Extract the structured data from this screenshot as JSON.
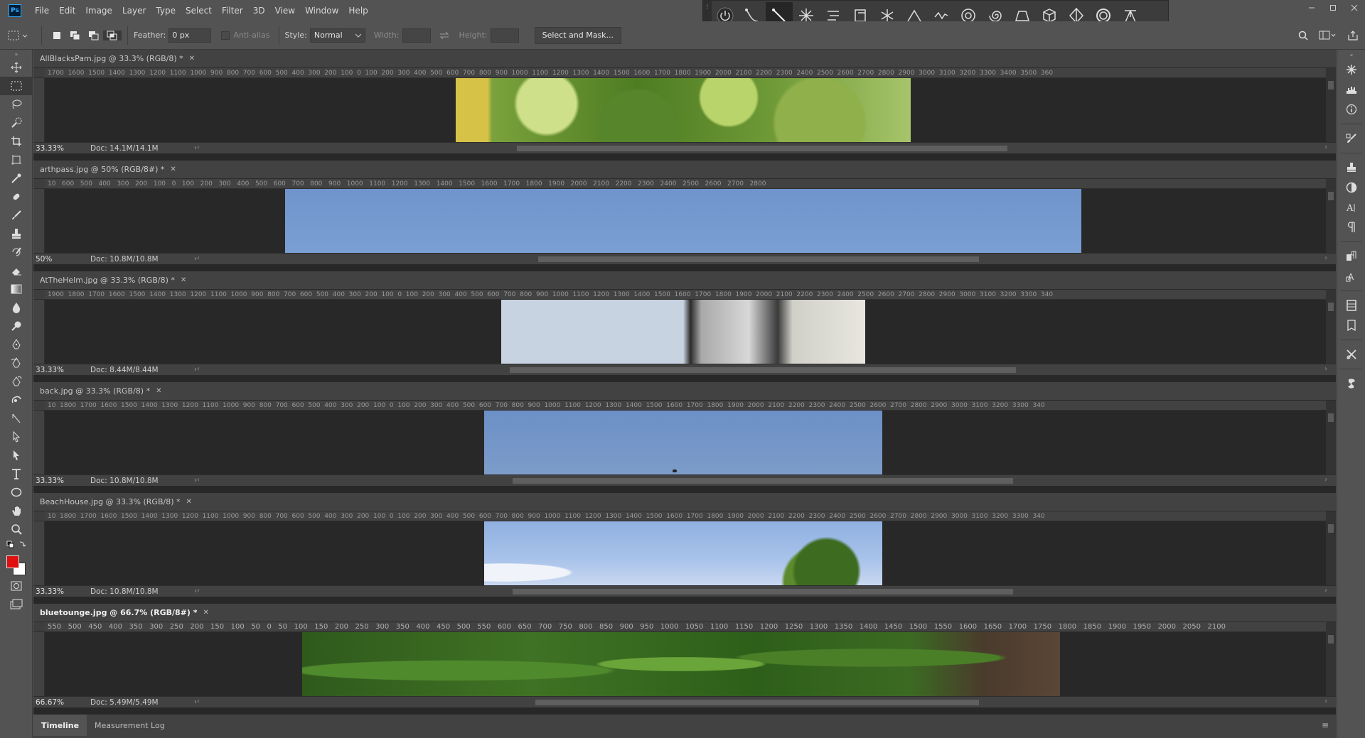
{
  "app": {
    "logo": "Ps",
    "menu": [
      "File",
      "Edit",
      "Image",
      "Layer",
      "Type",
      "Select",
      "Filter",
      "3D",
      "View",
      "Window",
      "Help"
    ],
    "window_controls": [
      "minimize-icon",
      "restore-icon",
      "close-icon"
    ]
  },
  "float_panel": {
    "icons": [
      "power-icon",
      "pen-curve-icon",
      "line-tool-icon",
      "starburst-icon",
      "align-lines-icon",
      "frame-icon",
      "snowflake-icon",
      "angle-icon",
      "wave-icon",
      "circle-target-icon",
      "spiral-icon",
      "perspective-box-icon",
      "cube-icon",
      "diamond-icon",
      "ring-icon",
      "tripod-icon"
    ]
  },
  "options": {
    "feather_label": "Feather:",
    "feather_value": "0 px",
    "antialias_label": "Anti-alias",
    "style_label": "Style:",
    "style_value": "Normal",
    "width_label": "Width:",
    "height_label": "Height:",
    "select_mask_label": "Select and Mask..."
  },
  "documents": [
    {
      "title": "AllBlacksPam.jpg @ 33.3% (RGB/8) *",
      "zoom": "33.33%",
      "doc_size": "Doc: 14.1M/14.1M",
      "ruler": "1700  1600  1500  1400  1300  1200  1100  1000  900  800  700  600  500  400  300  200  100  0  100  200  300  400  500  600  700  800  900  1000  1100  1200  1300  1400  1500  1600  1700  1800  1900  2000  2100  2200  2300  2400  2500  2600  2700  2800  2900  3000  3100  3200  3300  3400  3500  360",
      "active": false
    },
    {
      "title": "arthpass.jpg @ 50% (RGB/8#) *",
      "zoom": "50%",
      "doc_size": "Doc: 10.8M/10.8M",
      "ruler": "10   600   500   400   300   200   100   0   100   200   300   400   500   600   700   800   900   1000   1100   1200   1300   1400   1500   1600   1700   1800   1900   2000   2100   2200   2300   2400   2500   2600   2700   2800",
      "active": false
    },
    {
      "title": "AtTheHelm.jpg @ 33.3% (RGB/8) *",
      "zoom": "33.33%",
      "doc_size": "Doc: 8.44M/8.44M",
      "ruler": "1900  1800  1700  1600  1500  1400  1300  1200  1100  1000  900  800  700  600  500  400  300  200  100  0  100  200  300  400  500  600  700  800  900  1000  1100  1200  1300  1400  1500  1600  1700  1800  1900  2000  2100  2200  2300  2400  2500  2600  2700  2800  2900  3000  3100  3200  3300  340",
      "active": false
    },
    {
      "title": "back.jpg @ 33.3% (RGB/8) *",
      "zoom": "33.33%",
      "doc_size": "Doc: 10.8M/10.8M",
      "ruler": "10  1800  1700  1600  1500  1400  1300  1200  1100  1000  900  800  700  600  500  400  300  200  100  0  100  200  300  400  500  600  700  800  900  1000  1100  1200  1300  1400  1500  1600  1700  1800  1900  2000  2100  2200  2300  2400  2500  2600  2700  2800  2900  3000  3100  3200  3300  340",
      "active": false
    },
    {
      "title": "BeachHouse.jpg @ 33.3% (RGB/8) *",
      "zoom": "33.33%",
      "doc_size": "Doc: 10.8M/10.8M",
      "ruler": "10  1800  1700  1600  1500  1400  1300  1200  1100  1000  900  800  700  600  500  400  300  200  100  0  100  200  300  400  500  600  700  800  900  1000  1100  1200  1300  1400  1500  1600  1700  1800  1900  2000  2100  2200  2300  2400  2500  2600  2700  2800  2900  3000  3100  3200  3300  340",
      "active": false
    },
    {
      "title": "bluetounge.jpg @ 66.7% (RGB/8#) *",
      "zoom": "66.67%",
      "doc_size": "Doc: 5.49M/5.49M",
      "ruler": "550   500   450   400   350   300   250   200   150   100   50   0   50   100   150   200   250   300   350   400   450   500   550   600   650   700   750   800   850   900   950   1000   1050   1100   1150   1200   1250   1300   1350   1400   1450   1500   1550   1600   1650   1700   1750   1800   1850   1900   1950   2000   2050   2100",
      "active": true
    }
  ],
  "bottom_panel": {
    "tabs": [
      "Timeline",
      "Measurement Log"
    ]
  },
  "colors": {
    "foreground": "#e01010",
    "background": "#ffffff"
  }
}
